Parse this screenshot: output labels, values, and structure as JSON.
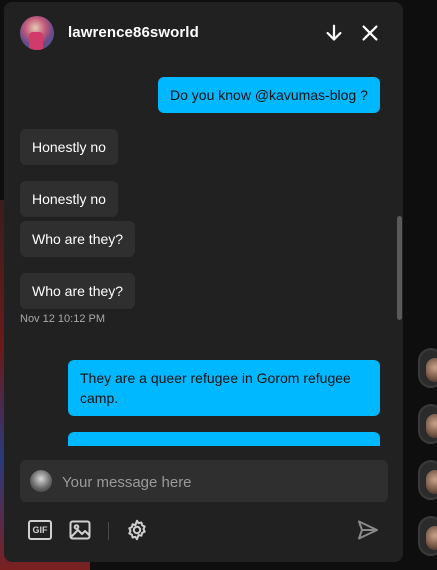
{
  "header": {
    "username": "lawrence86sworld",
    "icons": {
      "scroll_down": "arrow-down-icon",
      "close": "close-icon"
    }
  },
  "messages": [
    {
      "side": "out",
      "text": "Do you know @kavumas-blog ?"
    },
    {
      "side": "in",
      "text": "Honestly no"
    },
    {
      "side": "in",
      "text": "Honestly no"
    },
    {
      "side": "in",
      "text": "Who are they?"
    },
    {
      "side": "in",
      "text": "Who are they?"
    },
    {
      "side": "out",
      "text": "They are a queer refugee in Gorom refugee camp."
    }
  ],
  "timestamp": "Nov 12 10:12 PM",
  "composer": {
    "placeholder": "Your message here"
  },
  "toolbar": {
    "gif_label": "GIF",
    "icons": {
      "image": "image-icon",
      "settings": "gear-icon",
      "send": "send-icon"
    }
  },
  "colors": {
    "panel": "#212121",
    "incoming_bubble": "#2f2f2f",
    "outgoing_bubble": "#00b8ff",
    "text": "#ffffff"
  }
}
